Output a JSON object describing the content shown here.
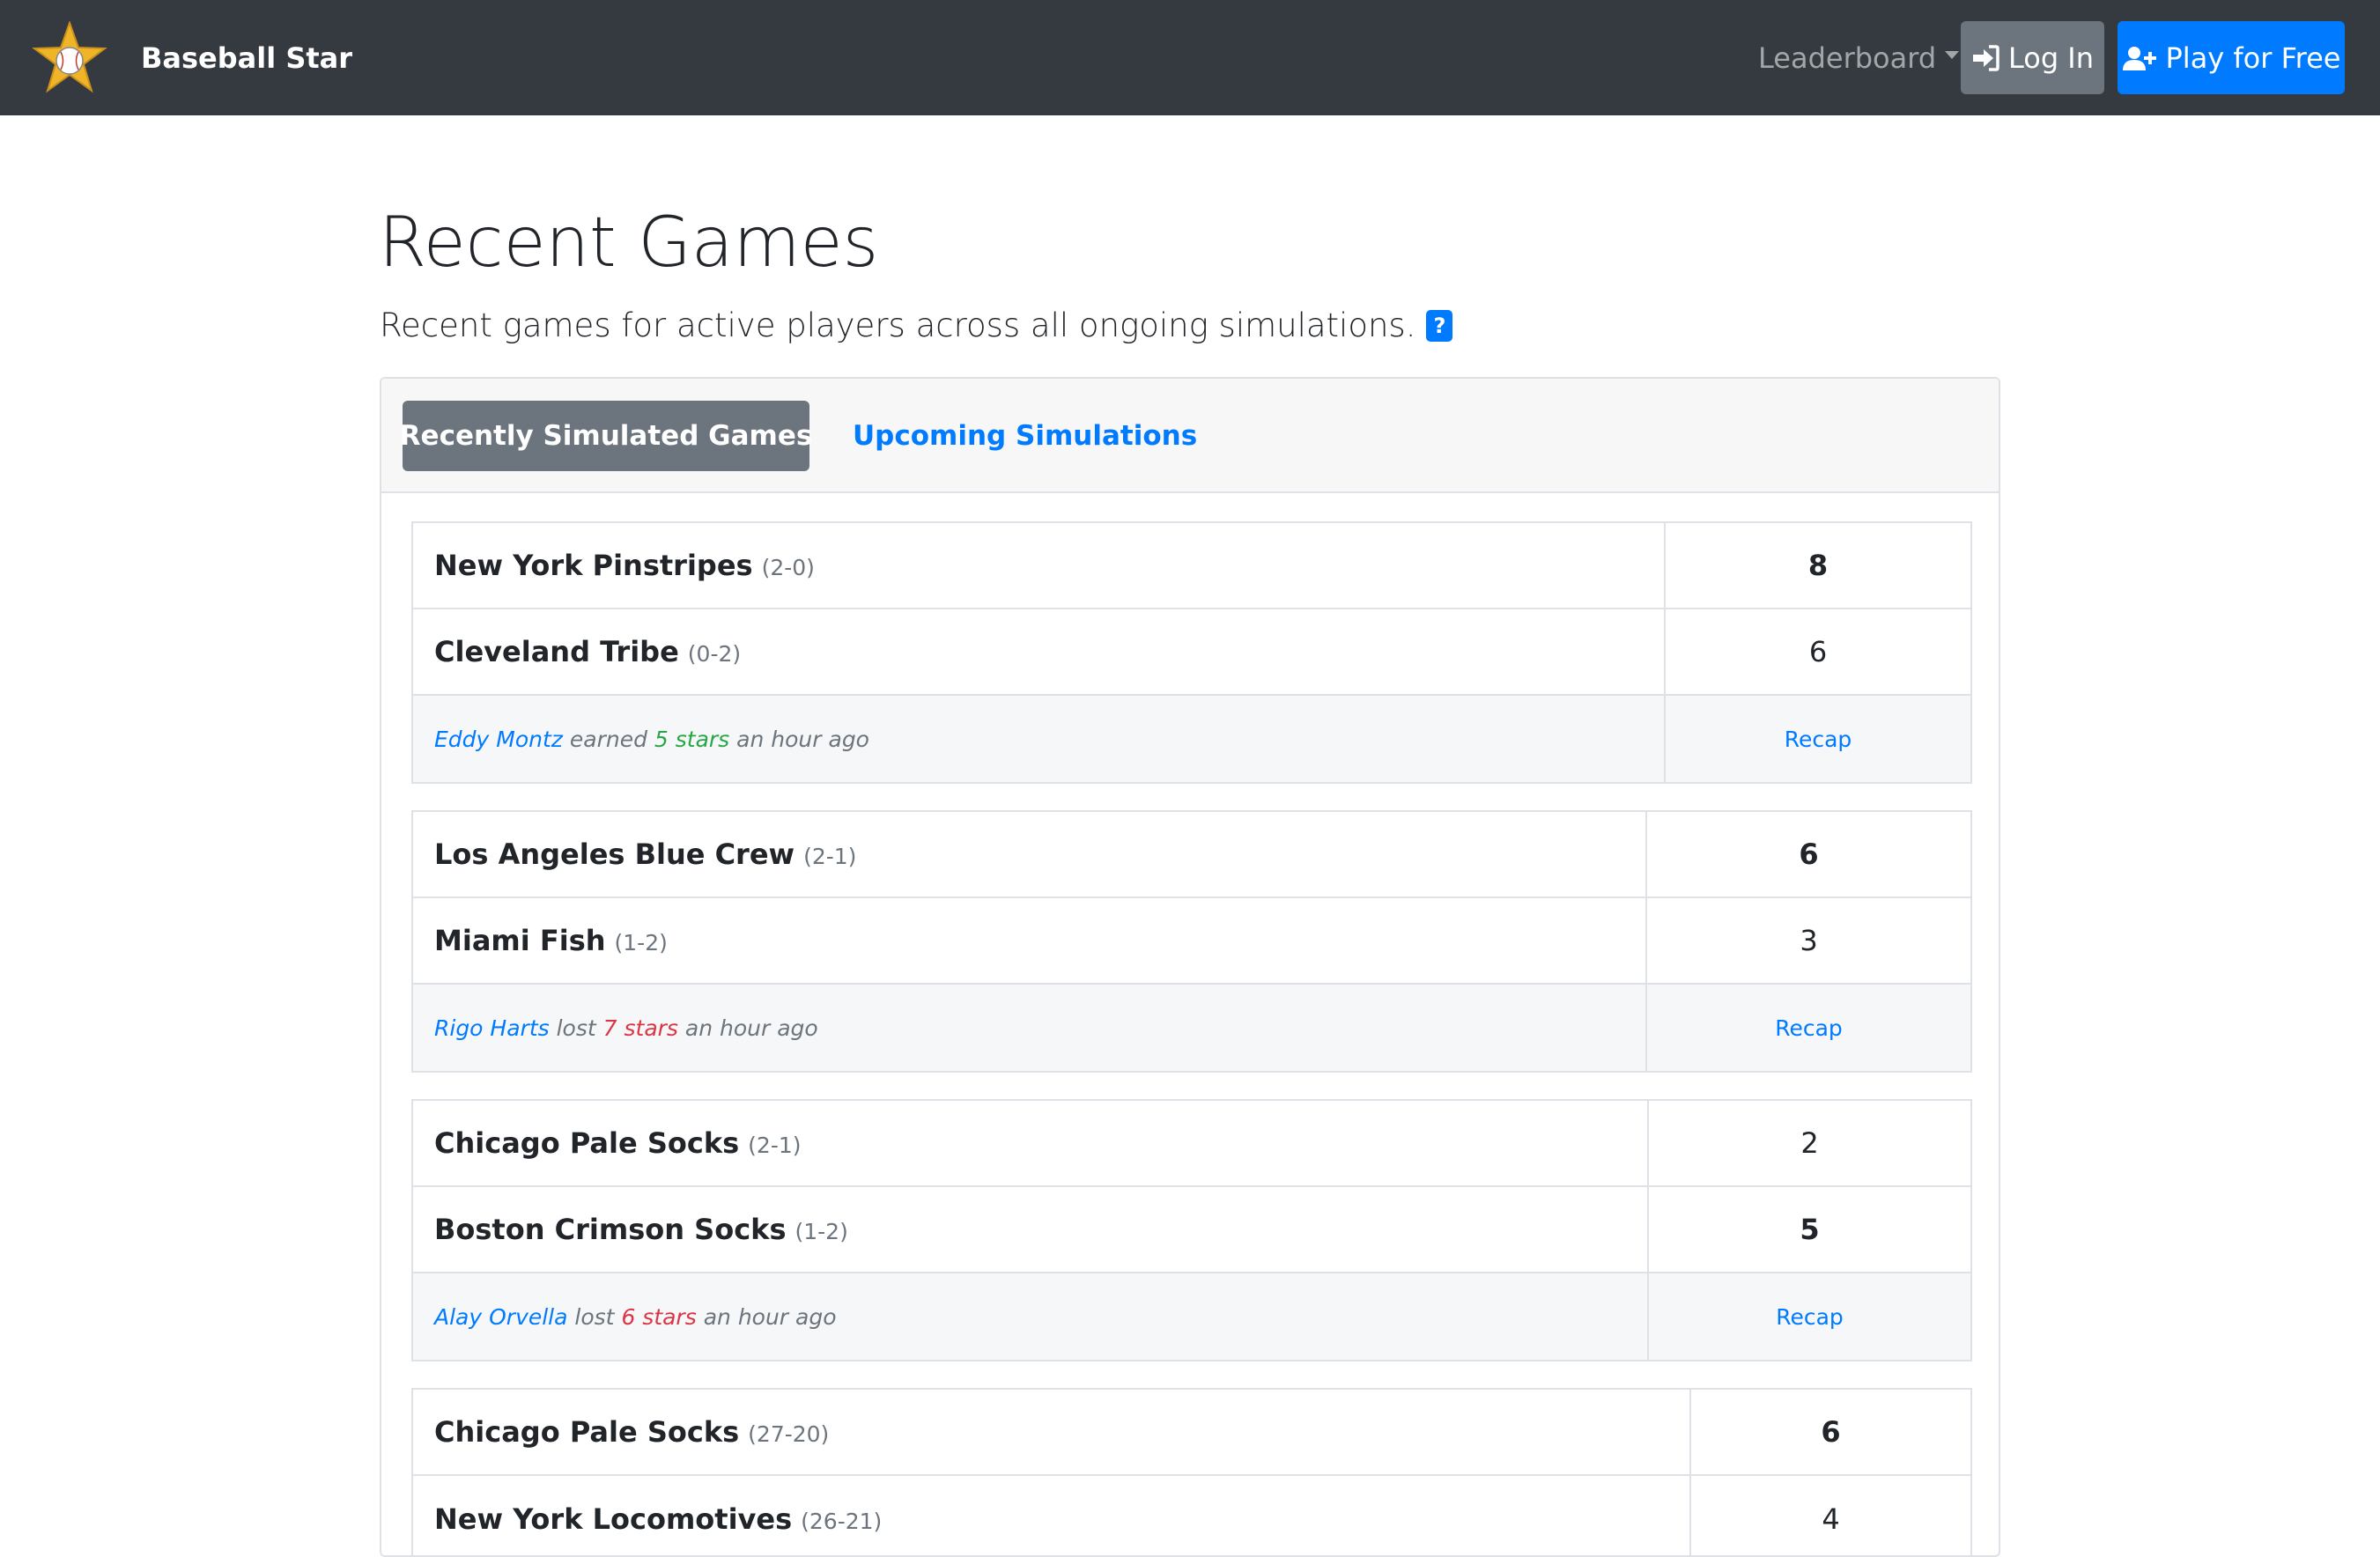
{
  "navbar": {
    "brand_name": "Baseball Star",
    "leaderboard_label": "Leaderboard",
    "login_label": "Log In",
    "play_label": "Play for Free",
    "colors": {
      "background": "#343a40",
      "login_button": "#6c757d",
      "play_button": "#007bff",
      "logo_star": "#f0b429"
    }
  },
  "page": {
    "title": "Recent Games",
    "subtitle": "Recent games for active players across all ongoing simulations.",
    "help_badge": "?"
  },
  "tabs": {
    "active": "Recently Simulated Games",
    "other": "Upcoming Simulations"
  },
  "games": [
    {
      "home": {
        "team": "New York Pinstripes",
        "record": "(2-0)",
        "score": "8",
        "winner": true
      },
      "away": {
        "team": "Cleveland Tribe",
        "record": "(0-2)",
        "score": "6",
        "winner": false
      },
      "result": {
        "player": "Eddy Montz",
        "verb": "earned",
        "stars": "5 stars",
        "outcome": "win",
        "time": "an hour ago"
      },
      "recap_label": "Recap"
    },
    {
      "home": {
        "team": "Los Angeles Blue Crew",
        "record": "(2-1)",
        "score": "6",
        "winner": true
      },
      "away": {
        "team": "Miami Fish",
        "record": "(1-2)",
        "score": "3",
        "winner": false
      },
      "result": {
        "player": "Rigo Harts",
        "verb": "lost",
        "stars": "7 stars",
        "outcome": "loss",
        "time": "an hour ago"
      },
      "recap_label": "Recap"
    },
    {
      "home": {
        "team": "Chicago Pale Socks",
        "record": "(2-1)",
        "score": "2",
        "winner": false
      },
      "away": {
        "team": "Boston Crimson Socks",
        "record": "(1-2)",
        "score": "5",
        "winner": true
      },
      "result": {
        "player": "Alay Orvella",
        "verb": "lost",
        "stars": "6 stars",
        "outcome": "loss",
        "time": "an hour ago"
      },
      "recap_label": "Recap"
    },
    {
      "home": {
        "team": "Chicago Pale Socks",
        "record": "(27-20)",
        "score": "6",
        "winner": true
      },
      "away": {
        "team": "New York Locomotives",
        "record": "(26-21)",
        "score": "4",
        "winner": false
      }
    }
  ],
  "colors": {
    "link": "#007bff",
    "stars_win": "#28a745",
    "stars_loss": "#dc3545",
    "muted": "#6c757d"
  }
}
